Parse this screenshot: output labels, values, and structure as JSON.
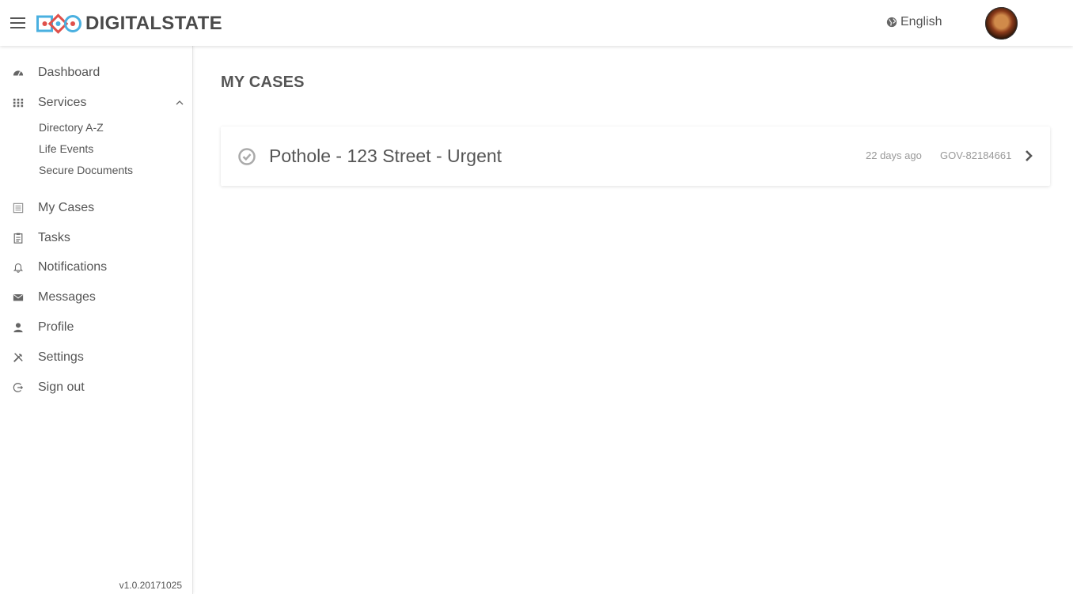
{
  "app": {
    "logo_text": "DIGITALSTATE",
    "brand_colors": {
      "blue": "#4ab0e0",
      "red": "#e0504a"
    }
  },
  "header": {
    "language_label": "English",
    "icons": {
      "menu": "hamburger-icon",
      "language": "globe-icon"
    }
  },
  "sidebar": {
    "items": [
      {
        "label": "Dashboard",
        "icon": "dashboard-icon"
      },
      {
        "label": "Services",
        "icon": "grid-icon"
      },
      {
        "label": "My Cases",
        "icon": "list-icon"
      },
      {
        "label": "Tasks",
        "icon": "clipboard-icon"
      },
      {
        "label": "Notifications",
        "icon": "bell-icon"
      },
      {
        "label": "Messages",
        "icon": "envelope-icon"
      },
      {
        "label": "Profile",
        "icon": "user-icon"
      },
      {
        "label": "Settings",
        "icon": "tools-icon"
      },
      {
        "label": "Sign out",
        "icon": "sign-out-icon"
      }
    ],
    "services_sub": [
      "Directory A-Z",
      "Life Events",
      "Secure Documents"
    ],
    "version": "v1.0.20171025"
  },
  "main": {
    "title": "MY CASES",
    "cases": [
      {
        "title": "Pothole - 123 Street - Urgent",
        "time": "22 days ago",
        "id": "GOV-82184661"
      }
    ]
  }
}
